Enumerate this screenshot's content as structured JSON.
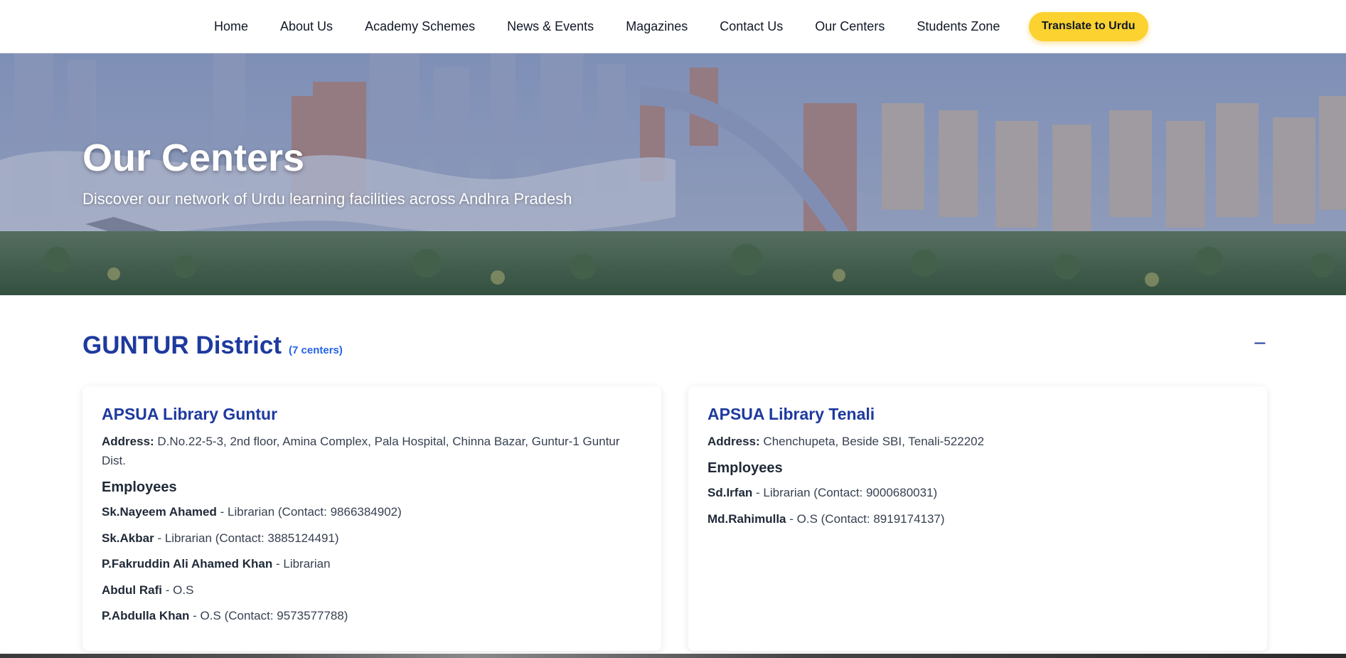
{
  "nav": {
    "items": [
      "Home",
      "About Us",
      "Academy Schemes",
      "News & Events",
      "Magazines",
      "Contact Us",
      "Our Centers",
      "Students Zone"
    ],
    "translate_label": "Translate to Urdu"
  },
  "hero": {
    "title": "Our Centers",
    "subtitle": "Discover our network of Urdu learning facilities across Andhra Pradesh"
  },
  "district": {
    "name": "GUNTUR District",
    "count": "(7 centers)",
    "toggle": "−",
    "centers": [
      {
        "name": "APSUA Library Guntur",
        "address_label": "Address:",
        "address": "D.No.22-5-3, 2nd floor, Amina Complex, Pala Hospital, Chinna Bazar, Guntur-1 Guntur Dist.",
        "employees_heading": "Employees",
        "employees": [
          {
            "name": "Sk.Nayeem Ahamed",
            "role": "- Librarian (Contact: 9866384902)"
          },
          {
            "name": "Sk.Akbar",
            "role": "- Librarian (Contact: 3885124491)"
          },
          {
            "name": "P.Fakruddin Ali Ahamed Khan",
            "role": "- Librarian"
          },
          {
            "name": "Abdul Rafi",
            "role": "- O.S"
          },
          {
            "name": "P.Abdulla Khan",
            "role": "- O.S (Contact: 9573577788)"
          }
        ]
      },
      {
        "name": "APSUA Library Tenali",
        "address_label": "Address:",
        "address": "Chenchupeta, Beside SBI, Tenali-522202",
        "employees_heading": "Employees",
        "employees": [
          {
            "name": "Sd.Irfan",
            "role": "- Librarian (Contact: 9000680031)"
          },
          {
            "name": "Md.Rahimulla",
            "role": "- O.S (Contact: 8919174137)"
          }
        ]
      }
    ]
  },
  "colors": {
    "accent_blue": "#1e3a9e",
    "count_blue": "#2563eb",
    "button_yellow": "#fbd22f"
  }
}
